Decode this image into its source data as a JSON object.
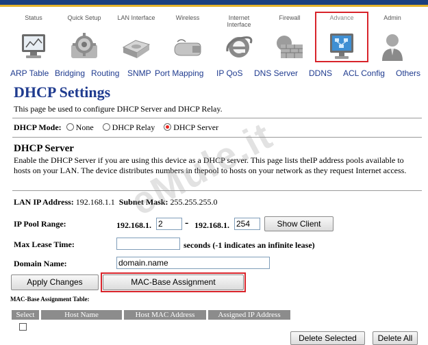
{
  "nav": {
    "items": [
      {
        "label": "Status",
        "icon": "monitor-icon"
      },
      {
        "label": "Quick Setup",
        "icon": "gear-icon"
      },
      {
        "label": "LAN Interface",
        "icon": "hard-drive-icon"
      },
      {
        "label": "Wireless",
        "icon": "usb-adapter-icon"
      },
      {
        "label": "Internet Interface",
        "icon": "internet-explorer-icon"
      },
      {
        "label": "Firewall",
        "icon": "brick-wall-icon"
      },
      {
        "label": "Advance",
        "icon": "network-monitor-icon",
        "selected": true
      },
      {
        "label": "Admin",
        "icon": "user-icon"
      }
    ]
  },
  "subnav": [
    "ARP Table",
    "Bridging",
    "Routing",
    "SNMP",
    "Port Mapping",
    "IP QoS",
    "DNS Server",
    "DDNS",
    "ACL Config",
    "Others"
  ],
  "page": {
    "title": "DHCP Settings",
    "description": "This page be used to configure DHCP Server and DHCP Relay."
  },
  "mode": {
    "label": "DHCP Mode:",
    "options": [
      "None",
      "DHCP Relay",
      "DHCP Server"
    ],
    "selected": "DHCP Server"
  },
  "server": {
    "title": "DHCP Server",
    "description": "Enable the DHCP Server if you are using this device as a DHCP server. This page lists theIP address pools available to hosts on your LAN. The device distributes numbers in thepool to hosts on your network as they request Internet access.",
    "lan_ip_label": "LAN IP Address:",
    "lan_ip": "192.168.1.1",
    "subnet_label": "Subnet Mask:",
    "subnet": "255.255.255.0",
    "pool_label": "IP Pool Range:",
    "pool_prefix": "192.168.1.",
    "pool_start": "2",
    "pool_dash": "-",
    "pool_end": "254",
    "show_client": "Show Client",
    "lease_label": "Max Lease Time:",
    "lease_value": "",
    "lease_hint": "seconds (-1 indicates an infinite lease)",
    "domain_label": "Domain Name:",
    "domain_value": "domain.name",
    "apply": "Apply Changes",
    "mac_assign": "MAC-Base Assignment"
  },
  "mac_table": {
    "title": "MAC-Base Assignment Table:",
    "headers": [
      "Select",
      "Host Name",
      "Host MAC Address",
      "Assigned IP Address"
    ],
    "delete_selected": "Delete Selected",
    "delete_all": "Delete All"
  },
  "watermark": "eMule.it",
  "colors": {
    "accent_blue": "#1f3b8f",
    "highlight_red": "#d8232a",
    "radio_on": "#e8231e"
  }
}
